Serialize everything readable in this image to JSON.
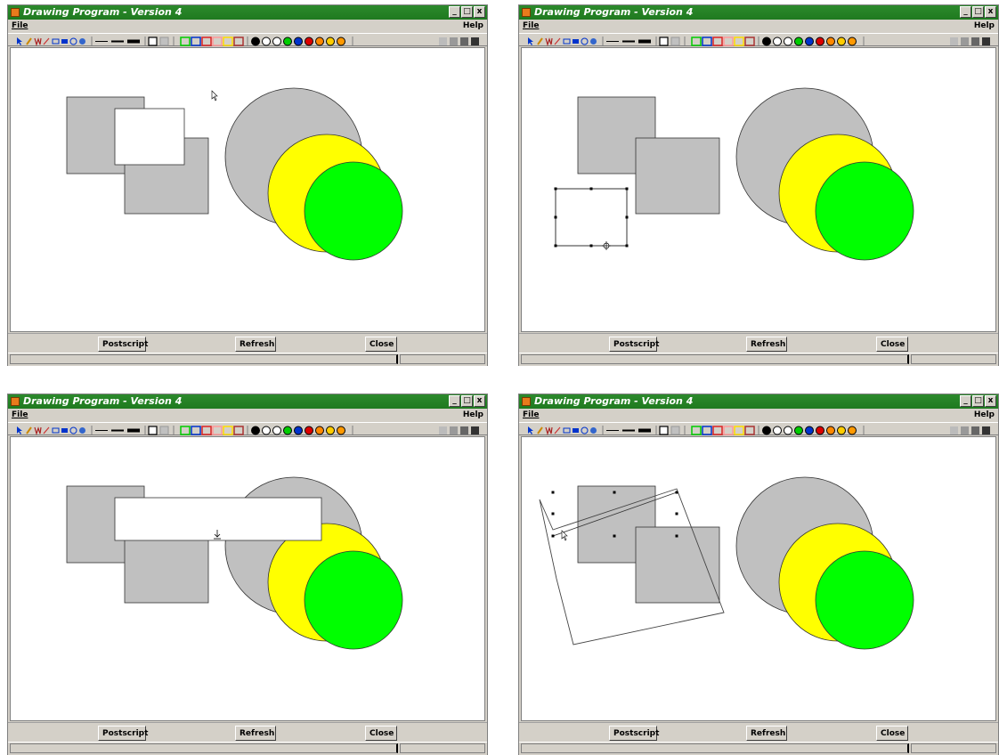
{
  "window": {
    "title": "Drawing Program - Version 4",
    "menu_file": "File",
    "menu_help": "Help",
    "btn_min": "_",
    "btn_max": "□",
    "btn_close": "x"
  },
  "buttons": {
    "postscript": "Postscript",
    "refresh": "Refresh",
    "close": "Close"
  },
  "toolbar": {
    "tools": [
      "select-arrow-icon",
      "pencil-icon",
      "polyline-icon",
      "line-icon",
      "rect-outline-icon",
      "rect-filled-icon",
      "circle-outline-icon",
      "circle-filled-icon"
    ],
    "line_widths": [
      "thin",
      "medium",
      "thick"
    ],
    "fill_modes": [
      "outline",
      "filled"
    ],
    "outline_colors": [
      "#00cc00",
      "#0033cc",
      "#dd2222",
      "#ff9999",
      "#ffdd00",
      "#aa3333"
    ],
    "fill_colors": [
      "#000000",
      "#ffffff",
      "#ffffff",
      "#00cc00",
      "#0033cc",
      "#dd0000",
      "#ff8800",
      "#ffcc00",
      "#ff9900"
    ],
    "gray_swatches": [
      "#bbbbbb",
      "#999999",
      "#666666",
      "#333333"
    ]
  },
  "colors": {
    "titlebar": "#1f7a1f",
    "shape_gray": "#c0c0c0",
    "yellow": "#ffff00",
    "green": "#00ff00"
  },
  "panels": [
    {
      "name": "panel-1",
      "description_state": "white rectangle overlapping gray squares"
    },
    {
      "name": "panel-2",
      "description_state": "selected empty rectangle with handles"
    },
    {
      "name": "panel-3",
      "description_state": "wide white rectangle being resized"
    },
    {
      "name": "panel-4",
      "description_state": "selection with rotated polygon outline"
    }
  ]
}
